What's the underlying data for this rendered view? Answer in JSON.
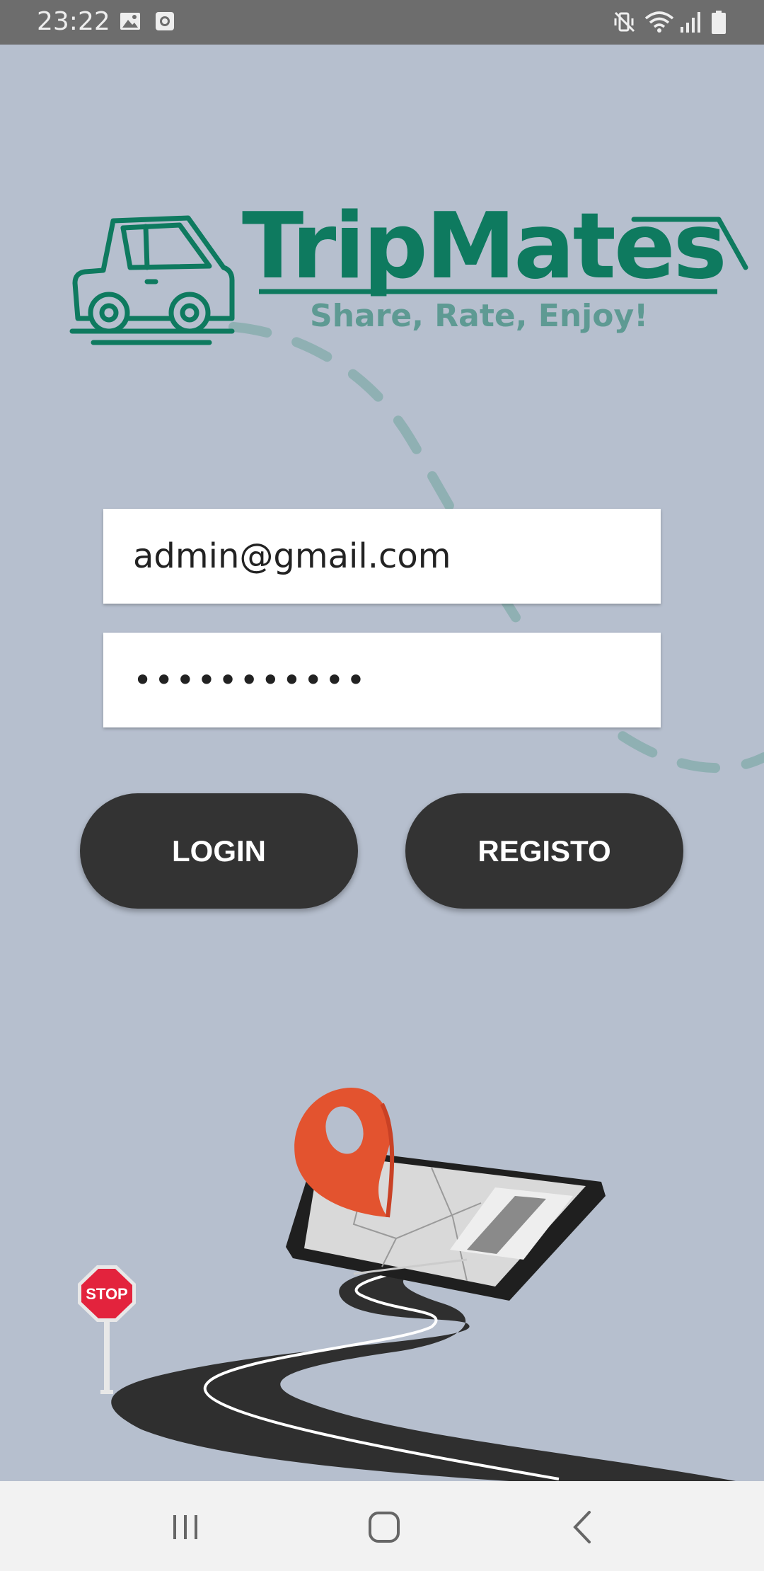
{
  "status_bar": {
    "time": "23:22",
    "left_icons": [
      "image-icon",
      "clock-app-icon"
    ],
    "right_icons": [
      "mute-vibrate-icon",
      "wifi-icon",
      "signal-icon",
      "battery-icon"
    ]
  },
  "logo": {
    "title": "TripMates",
    "tagline": "Share, Rate, Enjoy!",
    "icon": "car-icon",
    "color": "#0e7a5f",
    "tagline_color": "#5e9a93"
  },
  "form": {
    "email_value": "admin@gmail.com",
    "password_masked": "•••••••••••"
  },
  "buttons": {
    "login_label": "LOGIN",
    "register_label": "REGISTO"
  },
  "illustration": {
    "stop_sign_text": "STOP",
    "elements": [
      "location-pin-icon",
      "map-tablet",
      "road",
      "stop-sign"
    ]
  },
  "nav_bar": {
    "items": [
      "recent-apps-icon",
      "home-icon",
      "back-icon"
    ]
  },
  "colors": {
    "background": "#b6bfce",
    "button": "#333333",
    "pin": "#e3532f"
  }
}
